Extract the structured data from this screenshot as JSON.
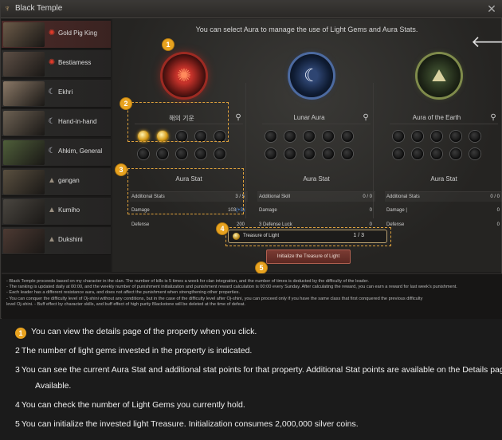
{
  "window": {
    "title": "Black Temple",
    "close_glyph": "✕"
  },
  "sidebar": {
    "items": [
      {
        "name": "Gold Pig King",
        "icon": "red-sun-icon",
        "selected": true,
        "portrait_color": "#6b5a48"
      },
      {
        "name": "Bestiamess",
        "icon": "red-sun-icon",
        "selected": false,
        "portrait_color": "#5d4f45"
      },
      {
        "name": "Ekhri",
        "icon": "moon-icon",
        "selected": false,
        "portrait_color": "#8a7866"
      },
      {
        "name": "Hand-in-hand",
        "icon": "moon-icon",
        "selected": false,
        "portrait_color": "#6d6153"
      },
      {
        "name": "Ahkim, General",
        "icon": "moon-icon",
        "selected": false,
        "portrait_color": "#4f5f3a"
      },
      {
        "name": "gangan",
        "icon": "earth-icon",
        "selected": false,
        "portrait_color": "#5a5040"
      },
      {
        "name": "Kumiho",
        "icon": "earth-icon",
        "selected": false,
        "portrait_color": "#4a4640"
      },
      {
        "name": "Dukshini",
        "icon": "earth-icon",
        "selected": false,
        "portrait_color": "#4d3a33"
      }
    ]
  },
  "main": {
    "headline": "You can select Aura to manage the use of Light Gems and Aura Stats.",
    "back_glyph": "🡐",
    "auras": [
      {
        "name": "해의 기운",
        "orb": "red",
        "icon": "sun-icon",
        "glyph": "✺",
        "gems_lit": 2,
        "gems_total": 10,
        "stat_head": "Aura Stat",
        "additional_label": "Additional Stats",
        "additional_value": "3 / 5",
        "stats": [
          {
            "label": "Damage",
            "value": "103",
            "bonus": "(+3)"
          },
          {
            "label": "Defense",
            "value": "200"
          }
        ]
      },
      {
        "name": "Lunar Aura",
        "orb": "blue",
        "icon": "moon-icon",
        "glyph": "☾",
        "gems_lit": 0,
        "gems_total": 10,
        "stat_head": "Aura Stat",
        "additional_label": "Additional Skill",
        "additional_value": "0 / 0",
        "stats": [
          {
            "label": "Damage",
            "value": "0"
          },
          {
            "label": "3 Defense Luck",
            "value": "0"
          }
        ]
      },
      {
        "name": "Aura of the Earth",
        "orb": "green",
        "icon": "earth-icon",
        "glyph": "⛰",
        "gems_lit": 0,
        "gems_total": 10,
        "stat_head": "Aura Stat",
        "additional_label": "Additional Stats",
        "additional_value": "0 / 0",
        "stats": [
          {
            "label": "Damage |",
            "value": "0"
          },
          {
            "label": "Defense",
            "value": "0"
          }
        ]
      }
    ],
    "treasure": {
      "label": "Treasure of Light",
      "value": "1 / 3"
    },
    "init_button": "Initialize the Treasure of Light"
  },
  "callouts": [
    "1",
    "2",
    "3",
    "4",
    "5"
  ],
  "notes": [
    "- Black Temple proceeds based on my character in the clan. The number of kills is 5 times a week for clan integration, and the number of times is deducted by the difficulty of the leader.",
    "- The ranking is updated daily at 00:00, and the weekly number of punishment initialization and punishment reward calculation is 00:00 every Sunday. After calculating the reward, you can earn a reward for last week's punishment.",
    "- Each leader has a different resistance aura, and does not affect the punishment when strengthening other properties.",
    "- You can conquer the difficulty level of Oj-shini without any conditions, but in the case of the difficulty level after Oj-shini, you can proceed only if you have the same class that first conquered the previous difficulty",
    "  level Oj-shini.  - Buff effect by character skills, and buff effect of high purity Blackstone will be deleted at the time of defeat."
  ],
  "legend": [
    {
      "num": "1",
      "style": "badge",
      "text": "You can view the details page of the property when you click."
    },
    {
      "num": "2",
      "style": "plain",
      "text": "The number of light gems invested in the property is indicated."
    },
    {
      "num": "3",
      "style": "plain",
      "text": "You can see the current Aura Stat and additional stat points for that property. Additional Stat points are available on the Details page"
    },
    {
      "num": "",
      "style": "cont",
      "text": "Available."
    },
    {
      "num": "4",
      "style": "plain",
      "text": "You can check the number of Light Gems you currently hold."
    },
    {
      "num": "5",
      "style": "plain",
      "text": "You can initialize the invested light Treasure. Initialization consumes 2,000,000 silver coins."
    }
  ],
  "colors": {
    "accent": "#e7a21f",
    "selected_row": "#4b2a28",
    "bonus_blue": "#5aa0ff"
  }
}
